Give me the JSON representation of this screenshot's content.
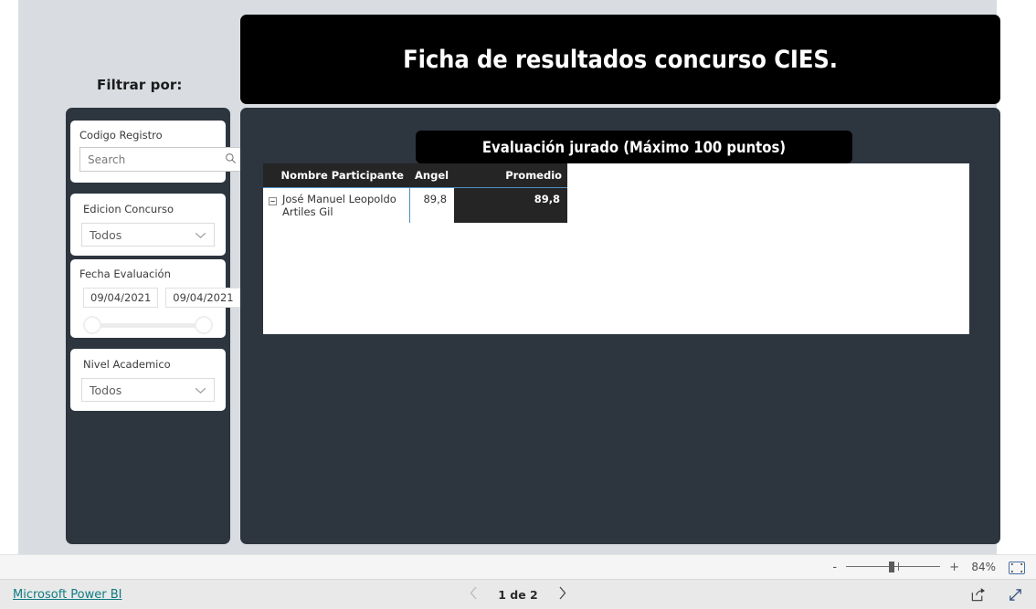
{
  "report": {
    "title": "Ficha de resultados concurso CIES.",
    "filter_label": "Filtrar por:",
    "section_title": "Evaluación jurado (Máximo 100 puntos)"
  },
  "slicers": {
    "codigo_registro": {
      "title": "Codigo Registro",
      "search_placeholder": "Search",
      "search_value": "",
      "search_icon": "magnifier-icon",
      "clear_icon": "eraser-icon"
    },
    "edicion_concurso": {
      "title": "Edicion Concurso",
      "selected": "Todos"
    },
    "fecha_evaluacion": {
      "title": "Fecha Evaluación",
      "start_date": "09/04/2021",
      "end_date": "09/04/2021"
    },
    "nivel_academico": {
      "title": "Nivel Academico",
      "selected": "Todos"
    }
  },
  "matrix": {
    "columns": [
      "Nombre Participante",
      "Angel",
      "Promedio"
    ],
    "rows": [
      {
        "name": "José Manuel Leopoldo Artiles Gil",
        "angel": "89,8",
        "promedio": "89,8"
      }
    ]
  },
  "status_bar": {
    "zoom_minus": "-",
    "zoom_plus": "+",
    "zoom_level": "84%",
    "fit_icon": "fit-to-page-icon"
  },
  "footer": {
    "brand": "Microsoft Power BI",
    "page_label": "1 de 2",
    "prev_icon": "chevron-left-icon",
    "next_icon": "chevron-right-icon",
    "share_icon": "share-icon",
    "fullscreen_icon": "fullscreen-icon"
  },
  "colors": {
    "canvas": "#d9dde1",
    "panel": "#2d353f",
    "banner": "#000000",
    "accent_link": "#117b82",
    "header_rule": "#4a90c4"
  }
}
